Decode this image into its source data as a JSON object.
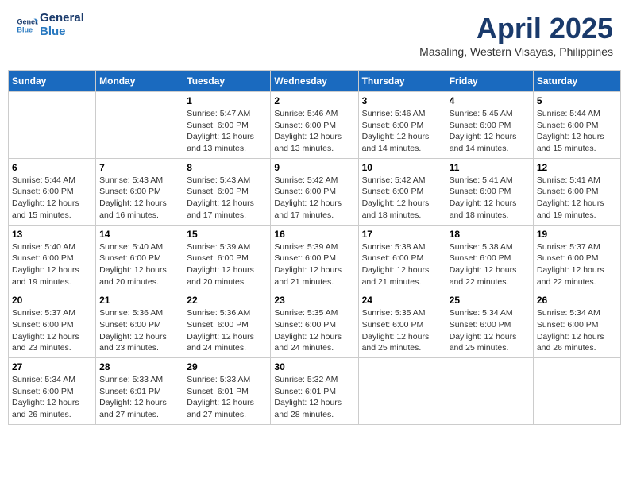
{
  "header": {
    "logo_line1": "General",
    "logo_line2": "Blue",
    "month": "April 2025",
    "location": "Masaling, Western Visayas, Philippines"
  },
  "weekdays": [
    "Sunday",
    "Monday",
    "Tuesday",
    "Wednesday",
    "Thursday",
    "Friday",
    "Saturday"
  ],
  "weeks": [
    [
      {
        "day": "",
        "info": ""
      },
      {
        "day": "",
        "info": ""
      },
      {
        "day": "1",
        "info": "Sunrise: 5:47 AM\nSunset: 6:00 PM\nDaylight: 12 hours and 13 minutes."
      },
      {
        "day": "2",
        "info": "Sunrise: 5:46 AM\nSunset: 6:00 PM\nDaylight: 12 hours and 13 minutes."
      },
      {
        "day": "3",
        "info": "Sunrise: 5:46 AM\nSunset: 6:00 PM\nDaylight: 12 hours and 14 minutes."
      },
      {
        "day": "4",
        "info": "Sunrise: 5:45 AM\nSunset: 6:00 PM\nDaylight: 12 hours and 14 minutes."
      },
      {
        "day": "5",
        "info": "Sunrise: 5:44 AM\nSunset: 6:00 PM\nDaylight: 12 hours and 15 minutes."
      }
    ],
    [
      {
        "day": "6",
        "info": "Sunrise: 5:44 AM\nSunset: 6:00 PM\nDaylight: 12 hours and 15 minutes."
      },
      {
        "day": "7",
        "info": "Sunrise: 5:43 AM\nSunset: 6:00 PM\nDaylight: 12 hours and 16 minutes."
      },
      {
        "day": "8",
        "info": "Sunrise: 5:43 AM\nSunset: 6:00 PM\nDaylight: 12 hours and 17 minutes."
      },
      {
        "day": "9",
        "info": "Sunrise: 5:42 AM\nSunset: 6:00 PM\nDaylight: 12 hours and 17 minutes."
      },
      {
        "day": "10",
        "info": "Sunrise: 5:42 AM\nSunset: 6:00 PM\nDaylight: 12 hours and 18 minutes."
      },
      {
        "day": "11",
        "info": "Sunrise: 5:41 AM\nSunset: 6:00 PM\nDaylight: 12 hours and 18 minutes."
      },
      {
        "day": "12",
        "info": "Sunrise: 5:41 AM\nSunset: 6:00 PM\nDaylight: 12 hours and 19 minutes."
      }
    ],
    [
      {
        "day": "13",
        "info": "Sunrise: 5:40 AM\nSunset: 6:00 PM\nDaylight: 12 hours and 19 minutes."
      },
      {
        "day": "14",
        "info": "Sunrise: 5:40 AM\nSunset: 6:00 PM\nDaylight: 12 hours and 20 minutes."
      },
      {
        "day": "15",
        "info": "Sunrise: 5:39 AM\nSunset: 6:00 PM\nDaylight: 12 hours and 20 minutes."
      },
      {
        "day": "16",
        "info": "Sunrise: 5:39 AM\nSunset: 6:00 PM\nDaylight: 12 hours and 21 minutes."
      },
      {
        "day": "17",
        "info": "Sunrise: 5:38 AM\nSunset: 6:00 PM\nDaylight: 12 hours and 21 minutes."
      },
      {
        "day": "18",
        "info": "Sunrise: 5:38 AM\nSunset: 6:00 PM\nDaylight: 12 hours and 22 minutes."
      },
      {
        "day": "19",
        "info": "Sunrise: 5:37 AM\nSunset: 6:00 PM\nDaylight: 12 hours and 22 minutes."
      }
    ],
    [
      {
        "day": "20",
        "info": "Sunrise: 5:37 AM\nSunset: 6:00 PM\nDaylight: 12 hours and 23 minutes."
      },
      {
        "day": "21",
        "info": "Sunrise: 5:36 AM\nSunset: 6:00 PM\nDaylight: 12 hours and 23 minutes."
      },
      {
        "day": "22",
        "info": "Sunrise: 5:36 AM\nSunset: 6:00 PM\nDaylight: 12 hours and 24 minutes."
      },
      {
        "day": "23",
        "info": "Sunrise: 5:35 AM\nSunset: 6:00 PM\nDaylight: 12 hours and 24 minutes."
      },
      {
        "day": "24",
        "info": "Sunrise: 5:35 AM\nSunset: 6:00 PM\nDaylight: 12 hours and 25 minutes."
      },
      {
        "day": "25",
        "info": "Sunrise: 5:34 AM\nSunset: 6:00 PM\nDaylight: 12 hours and 25 minutes."
      },
      {
        "day": "26",
        "info": "Sunrise: 5:34 AM\nSunset: 6:00 PM\nDaylight: 12 hours and 26 minutes."
      }
    ],
    [
      {
        "day": "27",
        "info": "Sunrise: 5:34 AM\nSunset: 6:00 PM\nDaylight: 12 hours and 26 minutes."
      },
      {
        "day": "28",
        "info": "Sunrise: 5:33 AM\nSunset: 6:01 PM\nDaylight: 12 hours and 27 minutes."
      },
      {
        "day": "29",
        "info": "Sunrise: 5:33 AM\nSunset: 6:01 PM\nDaylight: 12 hours and 27 minutes."
      },
      {
        "day": "30",
        "info": "Sunrise: 5:32 AM\nSunset: 6:01 PM\nDaylight: 12 hours and 28 minutes."
      },
      {
        "day": "",
        "info": ""
      },
      {
        "day": "",
        "info": ""
      },
      {
        "day": "",
        "info": ""
      }
    ]
  ]
}
